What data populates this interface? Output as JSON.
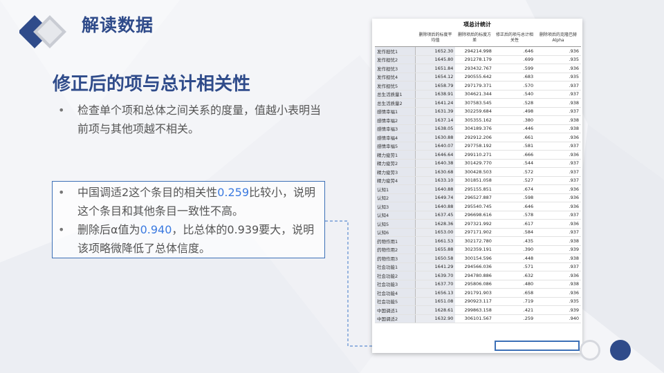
{
  "header": {
    "title": "解读数据"
  },
  "section": {
    "heading": "修正后的项与总计相关性"
  },
  "intro_bullets": [
    "检查单个项和总体之间关系的度量，值越小表明当前项与其他项越不相关。"
  ],
  "box_bullets": [
    {
      "pre": "中国调适2这个条目的相关性",
      "hl": "0.259",
      "post": "比较小，说明这个条目和其他条目一致性不高。"
    },
    {
      "pre": "删除后α值为",
      "hl": "0.940",
      "post": "，比总体的0.939要大，说明该项略微降低了总体信度。"
    }
  ],
  "table": {
    "caption": "项总计统计",
    "headers": [
      "删除项后的标度平均值",
      "删除项后的标度方差",
      "修正后的项与总计相关性",
      "删除项后的克隆巴赫 Alpha"
    ],
    "rows": [
      [
        "发作担忧1",
        "1652.30",
        "294214.998",
        ".646",
        ".936"
      ],
      [
        "发作担忧2",
        "1645.80",
        "291278.179",
        ".699",
        ".935"
      ],
      [
        "发作担忧3",
        "1651.84",
        "293432.767",
        ".599",
        ".936"
      ],
      [
        "发作担忧4",
        "1654.12",
        "290555.642",
        ".683",
        ".935"
      ],
      [
        "发作担忧5",
        "1658.79",
        "297179.371",
        ".570",
        ".937"
      ],
      [
        "总生活质量1",
        "1638.91",
        "304621.344",
        ".540",
        ".937"
      ],
      [
        "总生活质量2",
        "1641.24",
        "307583.545",
        ".528",
        ".938"
      ],
      [
        "感情幸福1",
        "1631.39",
        "302259.684",
        ".498",
        ".937"
      ],
      [
        "感情幸福2",
        "1637.14",
        "305355.162",
        ".380",
        ".938"
      ],
      [
        "感情幸福3",
        "1638.05",
        "304189.376",
        ".446",
        ".938"
      ],
      [
        "感情幸福4",
        "1630.88",
        "292912.206",
        ".661",
        ".936"
      ],
      [
        "感情幸福5",
        "1640.07",
        "297758.192",
        ".581",
        ".937"
      ],
      [
        "精力疲劳1",
        "1646.64",
        "299110.271",
        ".666",
        ".936"
      ],
      [
        "精力疲劳2",
        "1640.38",
        "301429.770",
        ".544",
        ".937"
      ],
      [
        "精力疲劳3",
        "1630.68",
        "300428.503",
        ".572",
        ".937"
      ],
      [
        "精力疲劳4",
        "1633.10",
        "301851.058",
        ".527",
        ".937"
      ],
      [
        "认知1",
        "1640.88",
        "295155.851",
        ".674",
        ".936"
      ],
      [
        "认知2",
        "1649.74",
        "296527.887",
        ".598",
        ".936"
      ],
      [
        "认知3",
        "1640.88",
        "295540.745",
        ".646",
        ".936"
      ],
      [
        "认知4",
        "1637.45",
        "296698.616",
        ".578",
        ".937"
      ],
      [
        "认知5",
        "1628.36",
        "297321.992",
        ".617",
        ".936"
      ],
      [
        "认知6",
        "1653.00",
        "297171.902",
        ".584",
        ".937"
      ],
      [
        "药物作用1",
        "1661.53",
        "302172.780",
        ".435",
        ".938"
      ],
      [
        "药物作用2",
        "1655.88",
        "302359.191",
        ".390",
        ".939"
      ],
      [
        "药物作用3",
        "1650.58",
        "300154.596",
        ".448",
        ".938"
      ],
      [
        "社会功能1",
        "1641.29",
        "294566.036",
        ".571",
        ".937"
      ],
      [
        "社会功能2",
        "1639.70",
        "294780.886",
        ".632",
        ".936"
      ],
      [
        "社会功能3",
        "1637.70",
        "295806.086",
        ".480",
        ".938"
      ],
      [
        "社会功能4",
        "1656.13",
        "291791.903",
        ".658",
        ".936"
      ],
      [
        "社会功能5",
        "1651.08",
        "290923.117",
        ".719",
        ".935"
      ],
      [
        "中国调适1",
        "1628.61",
        "299863.158",
        ".421",
        ".939"
      ],
      [
        "中国调适2",
        "1632.90",
        "306101.567",
        ".259",
        ".940"
      ]
    ]
  }
}
